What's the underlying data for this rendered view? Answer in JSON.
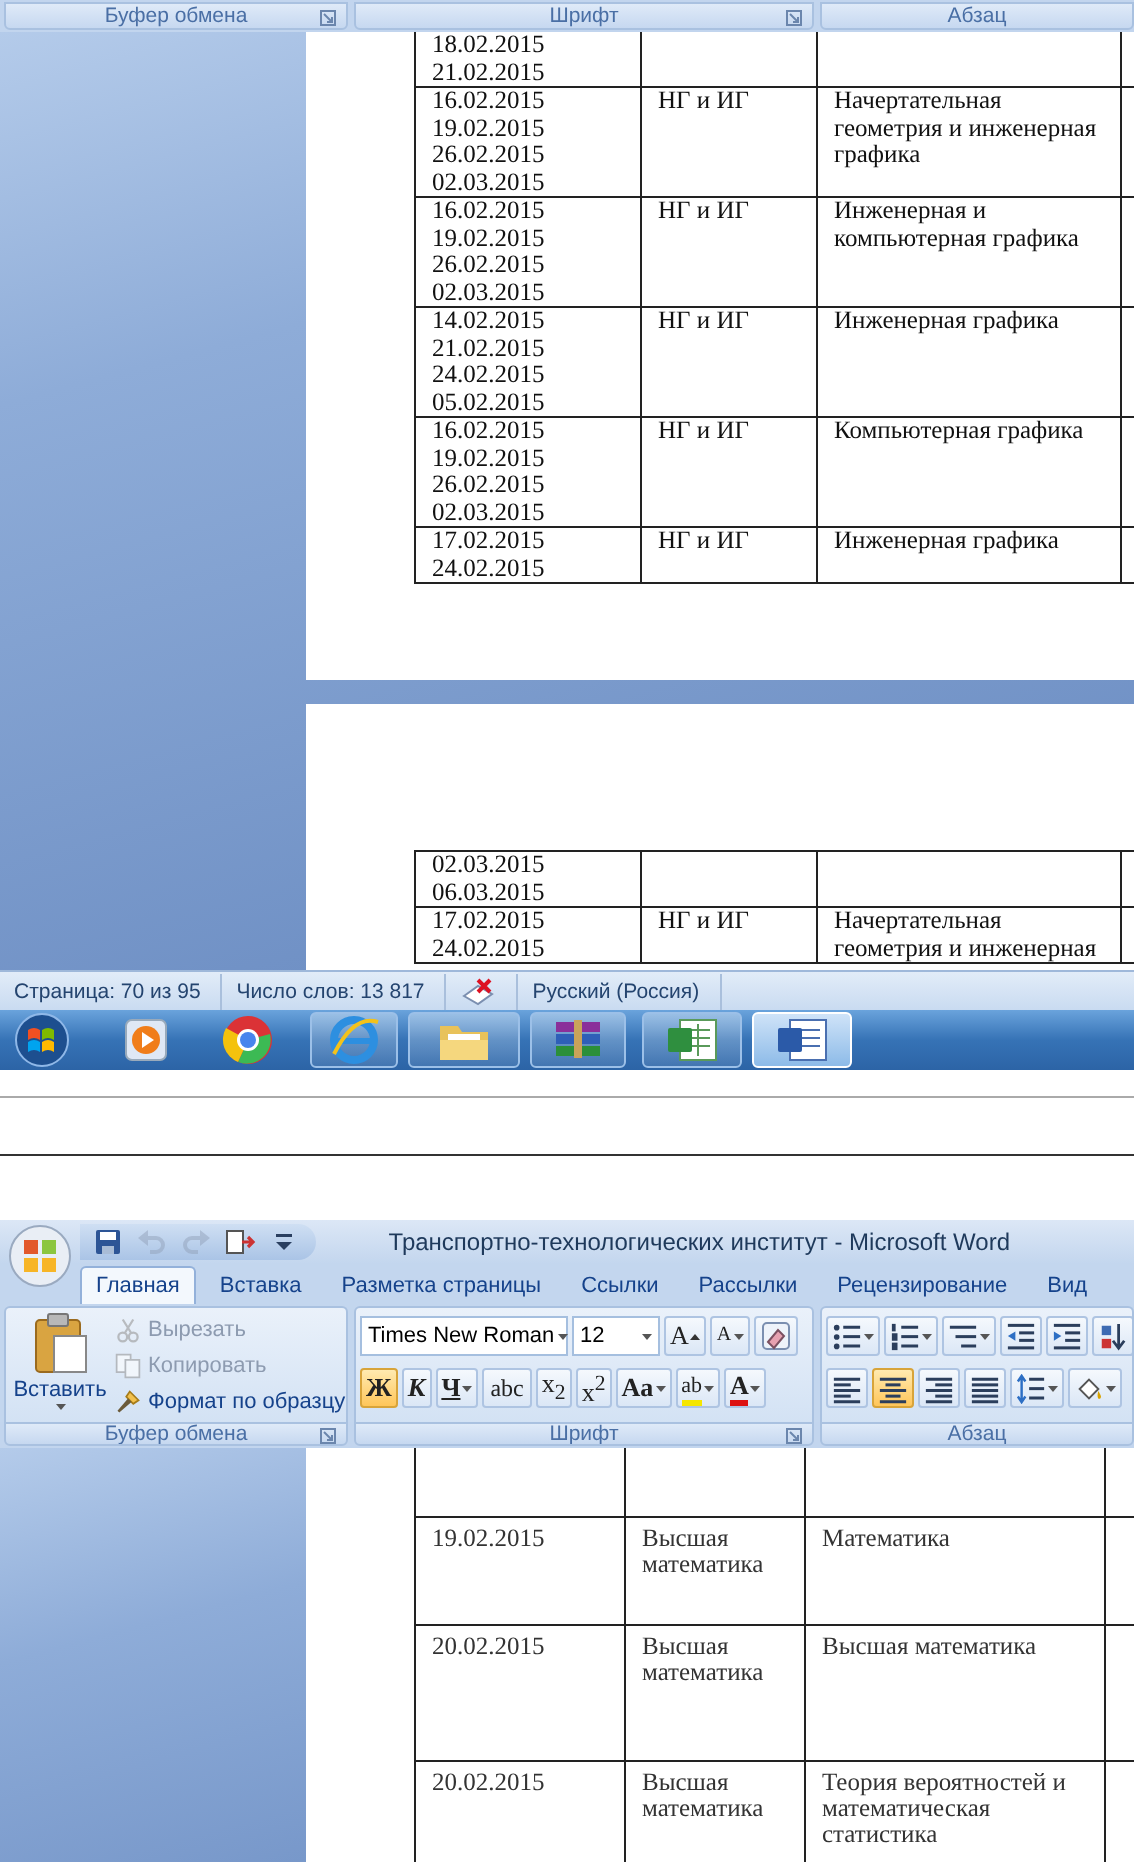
{
  "upper_screen": {
    "ribbon_groups": [
      {
        "label": "Буфер обмена",
        "launcher": true
      },
      {
        "label": "Шрифт",
        "launcher": true
      },
      {
        "label": "Абзац",
        "launcher": false
      }
    ],
    "pages": [
      {
        "rows": [
          {
            "column_1": "18.02.2015\n21.02.2015"
          },
          {
            "column_1": "16.02.2015\n19.02.2015\n26.02.2015\n02.03.2015",
            "column_2": "НГ и ИГ",
            "column_3": "Начертательная геометрия и инженерная графика"
          },
          {
            "column_1": "16.02.2015\n19.02.2015\n26.02.2015\n02.03.2015",
            "column_2": "НГ и ИГ",
            "column_3": "Инженерная и компьютерная графика"
          },
          {
            "column_1": "14.02.2015\n21.02.2015\n24.02.2015\n05.02.2015",
            "column_2": "НГ и ИГ",
            "column_3": "Инженерная графика"
          },
          {
            "column_1": "16.02.2015\n19.02.2015\n26.02.2015\n02.03.2015",
            "column_2": "НГ и ИГ",
            "column_3": "Компьютерная графика"
          },
          {
            "column_1": "17.02.2015\n24.02.2015",
            "column_2": "НГ и ИГ",
            "column_3": "Инженерная графика"
          }
        ]
      },
      {
        "rows": [
          {
            "column_1": "02.03.2015\n06.03.2015"
          },
          {
            "column_1": "17.02.2015\n24.02.2015",
            "column_2": "НГ и ИГ",
            "column_3": "Начертательная геометрия и инженерная"
          }
        ]
      }
    ],
    "status_bar": [
      {
        "kind": "text",
        "text": "Страница: 70 из 95"
      },
      {
        "kind": "text",
        "text": "Число слов: 13 817"
      },
      {
        "kind": "spellcheck"
      },
      {
        "kind": "text",
        "text": "Русский (Россия)"
      }
    ],
    "taskbar": [
      {
        "kind": "start",
        "running": false,
        "selected": false
      },
      {
        "kind": "player",
        "running": false,
        "selected": false
      },
      {
        "kind": "round_browser",
        "running": false,
        "selected": false
      },
      {
        "kind": "e_browser",
        "running": true,
        "selected": false
      },
      {
        "kind": "folder",
        "running": true,
        "selected": false
      },
      {
        "kind": "archive",
        "running": true,
        "selected": false
      },
      {
        "kind": "spreadsheet",
        "running": true,
        "selected": false
      },
      {
        "kind": "word_processor",
        "running": true,
        "selected": true
      }
    ]
  },
  "lower_screen": {
    "title": "Транспортно-технологических институт - Microsoft Word",
    "quick_access": [
      {
        "kind": "save",
        "disabled": false
      },
      {
        "kind": "undo",
        "disabled": true
      },
      {
        "kind": "redo",
        "disabled": true
      },
      {
        "kind": "print",
        "disabled": false
      },
      {
        "kind": "customize",
        "disabled": false
      }
    ],
    "tabs": [
      {
        "label": "Главная",
        "selected": true
      },
      {
        "label": "Вставка",
        "selected": false
      },
      {
        "label": "Разметка страницы",
        "selected": false
      },
      {
        "label": "Ссылки",
        "selected": false
      },
      {
        "label": "Рассылки",
        "selected": false
      },
      {
        "label": "Рецензирование",
        "selected": false
      },
      {
        "label": "Вид",
        "selected": false
      }
    ],
    "clipboard": {
      "paste": "Вставить",
      "commands": [
        {
          "kind": "cut",
          "label": "Вырезать",
          "disabled": true
        },
        {
          "kind": "copy",
          "label": "Копировать",
          "disabled": true
        },
        {
          "kind": "painter",
          "label": "Формат по образцу",
          "disabled": false
        }
      ]
    },
    "font": {
      "name": "Times New Roman",
      "size": "12",
      "tools": [
        {
          "kind": "grow",
          "label": "A"
        },
        {
          "kind": "shrink",
          "label": "A"
        },
        {
          "kind": "clear"
        }
      ],
      "format": [
        {
          "kind": "bold",
          "label": "Ж",
          "selected": true,
          "menu": false
        },
        {
          "kind": "italic",
          "label": "К",
          "selected": false,
          "menu": false
        },
        {
          "kind": "underline",
          "label": "Ч",
          "selected": false,
          "menu": true
        },
        {
          "kind": "strike",
          "label": "abc",
          "selected": false,
          "menu": false
        },
        {
          "kind": "subscript",
          "label": "x$_{2}$",
          "selected": false,
          "menu": false
        },
        {
          "kind": "superscript",
          "label": "x$^{2}$",
          "selected": false,
          "menu": false
        },
        {
          "kind": "case",
          "label": "Aa",
          "selected": false,
          "menu": true
        },
        {
          "kind": "highlight",
          "label": "ab",
          "selected": false,
          "menu": true
        },
        {
          "kind": "color",
          "label": "A",
          "selected": false,
          "menu": true
        }
      ]
    },
    "paragraph": {
      "row_1": [
        {
          "kind": "bullets",
          "menu": true
        },
        {
          "kind": "numbering",
          "menu": true
        },
        {
          "kind": "multilevel",
          "menu": true
        },
        {
          "kind": "outdent",
          "menu": false
        },
        {
          "kind": "indent",
          "menu": false
        },
        {
          "kind": "sort",
          "menu": false
        }
      ],
      "row_2": [
        {
          "kind": "align_left",
          "selected": false,
          "menu": false
        },
        {
          "kind": "align_center",
          "selected": true,
          "menu": false
        },
        {
          "kind": "align_right",
          "selected": false,
          "menu": false
        },
        {
          "kind": "justify",
          "selected": false,
          "menu": false
        },
        {
          "kind": "line_spacing",
          "selected": false,
          "menu": true
        },
        {
          "kind": "shading",
          "selected": false,
          "menu": true
        }
      ]
    },
    "ribbon_groups": [
      {
        "label": "Буфер обмена",
        "launcher": true
      },
      {
        "label": "Шрифт",
        "launcher": true
      },
      {
        "label": "Абзац",
        "launcher": false
      }
    ],
    "rows": [
      {},
      {
        "column_1": "19.02.2015",
        "column_2": "Высшая математика",
        "column_3": "Математика"
      },
      {
        "column_1": "20.02.2015",
        "column_2": "Высшая математика",
        "column_3": "Высшая математика"
      },
      {
        "column_1": "20.02.2015",
        "column_2": "Высшая математика",
        "column_3": "Теория вероятностей и математическая статистика"
      }
    ]
  }
}
